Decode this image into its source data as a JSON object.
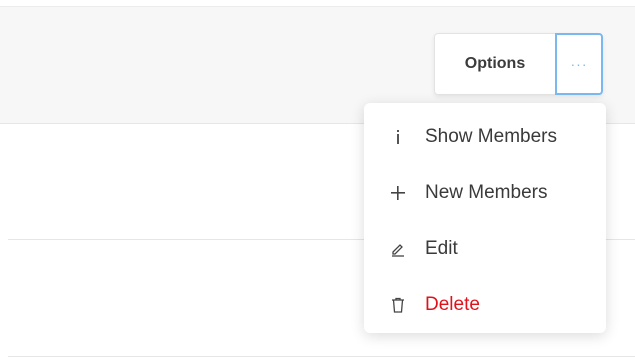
{
  "toolbar": {
    "options_label": "Options",
    "more_label": "···"
  },
  "menu": {
    "items": [
      {
        "label": "Show Members",
        "icon": "info-icon"
      },
      {
        "label": "New Members",
        "icon": "plus-icon"
      },
      {
        "label": "Edit",
        "icon": "pencil-icon"
      },
      {
        "label": "Delete",
        "icon": "trash-icon",
        "color": "#e0131a"
      }
    ]
  }
}
